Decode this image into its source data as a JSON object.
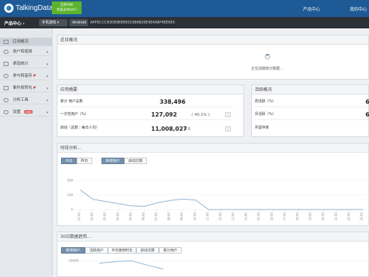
{
  "header": {
    "brand": "TalkingData",
    "promo_line1": "全新SDK",
    "promo_line2": "完美支持iOS7",
    "link_product_center": "产品中心",
    "link_account_center": "我的中心"
  },
  "subnav": {
    "crumb": "产品中心",
    "platform_select": "手机游戏",
    "os_select": "Android",
    "appid": "APPID:CC83D89E86831986B26E4E4A8F4EE665"
  },
  "sidebar": {
    "items": [
      {
        "label": "应用概况",
        "icon": "overview-icon",
        "active": true
      },
      {
        "label": "用户和使用",
        "icon": "user-icon",
        "arrow": "▾"
      },
      {
        "label": "渠道统计",
        "icon": "channel-icon",
        "arrow": "▾"
      },
      {
        "label": "参与和留存",
        "icon": "retention-icon",
        "arrow": "▾"
      },
      {
        "label": "事件和转化",
        "icon": "event-icon",
        "arrow": "▾"
      },
      {
        "label": "分析工具",
        "icon": "analysis-icon",
        "arrow": "▾"
      },
      {
        "label": "设置",
        "icon": "settings-icon",
        "badge": "new",
        "arrow": "▾"
      }
    ]
  },
  "recent": {
    "title": "近日概况",
    "loading_text": "正在加载统计数据..."
  },
  "summary": {
    "title": "应用摘要",
    "rows": [
      {
        "label": "累计 用户总数",
        "value": "338,496",
        "sub": "",
        "btn": ""
      },
      {
        "label": "一次性用户（%）",
        "value": "127,092",
        "sub": "( 40.1% )",
        "btn": "i"
      },
      {
        "label": "启动（总数｜每日人均）",
        "value": "11,008,027",
        "sub": "| 6.0",
        "btn": "i"
      }
    ]
  },
  "activity": {
    "title": "活跃概况",
    "rows": [
      {
        "label": "周活跃（%）",
        "value": "6"
      },
      {
        "label": "月活跃（%）",
        "value": "6"
      },
      {
        "label": "月留存率",
        "value": ""
      }
    ]
  },
  "hourly": {
    "title": "时段分析...",
    "day_buttons": [
      "今日",
      "昨日"
    ],
    "metric_buttons": [
      "新增用户",
      "启动次数"
    ]
  },
  "trend": {
    "title": "30日数据趋势...",
    "metric_buttons": [
      "新增用户",
      "活跃用户",
      "平均使用时长",
      "启动次数",
      "累计用户"
    ]
  },
  "colors": {
    "topbar": "#1e5a96",
    "accent": "#7390ab",
    "line": "#8bb2d6"
  },
  "chart_data": [
    {
      "type": "line",
      "title": "时段分析...",
      "x": [
        "01:00",
        "02:00",
        "03:00",
        "04:00",
        "05:00",
        "06:00",
        "07:00",
        "08:00",
        "09:00",
        "10:00",
        "11:00",
        "12:00",
        "13:00",
        "14:00",
        "15:00",
        "16:00",
        "17:00",
        "18:00",
        "19:00",
        "20:00",
        "21:00",
        "22:00",
        "23:00"
      ],
      "series": [
        {
          "values": [
            135,
            70,
            55,
            40,
            25,
            22,
            45,
            62,
            72,
            65,
            0,
            0,
            0,
            0,
            0,
            0,
            0,
            0,
            0,
            0,
            0,
            0,
            0
          ]
        }
      ],
      "ylim": [
        0,
        200
      ],
      "yticks": [
        "200",
        "100",
        "0"
      ]
    },
    {
      "type": "line",
      "title": "30日数据趋势...",
      "series": [
        {
          "values": [
            9000,
            9600,
            10000,
            8200,
            6600
          ]
        }
      ],
      "ylim": [
        0,
        10000
      ],
      "yticks": [
        "10000"
      ]
    }
  ]
}
